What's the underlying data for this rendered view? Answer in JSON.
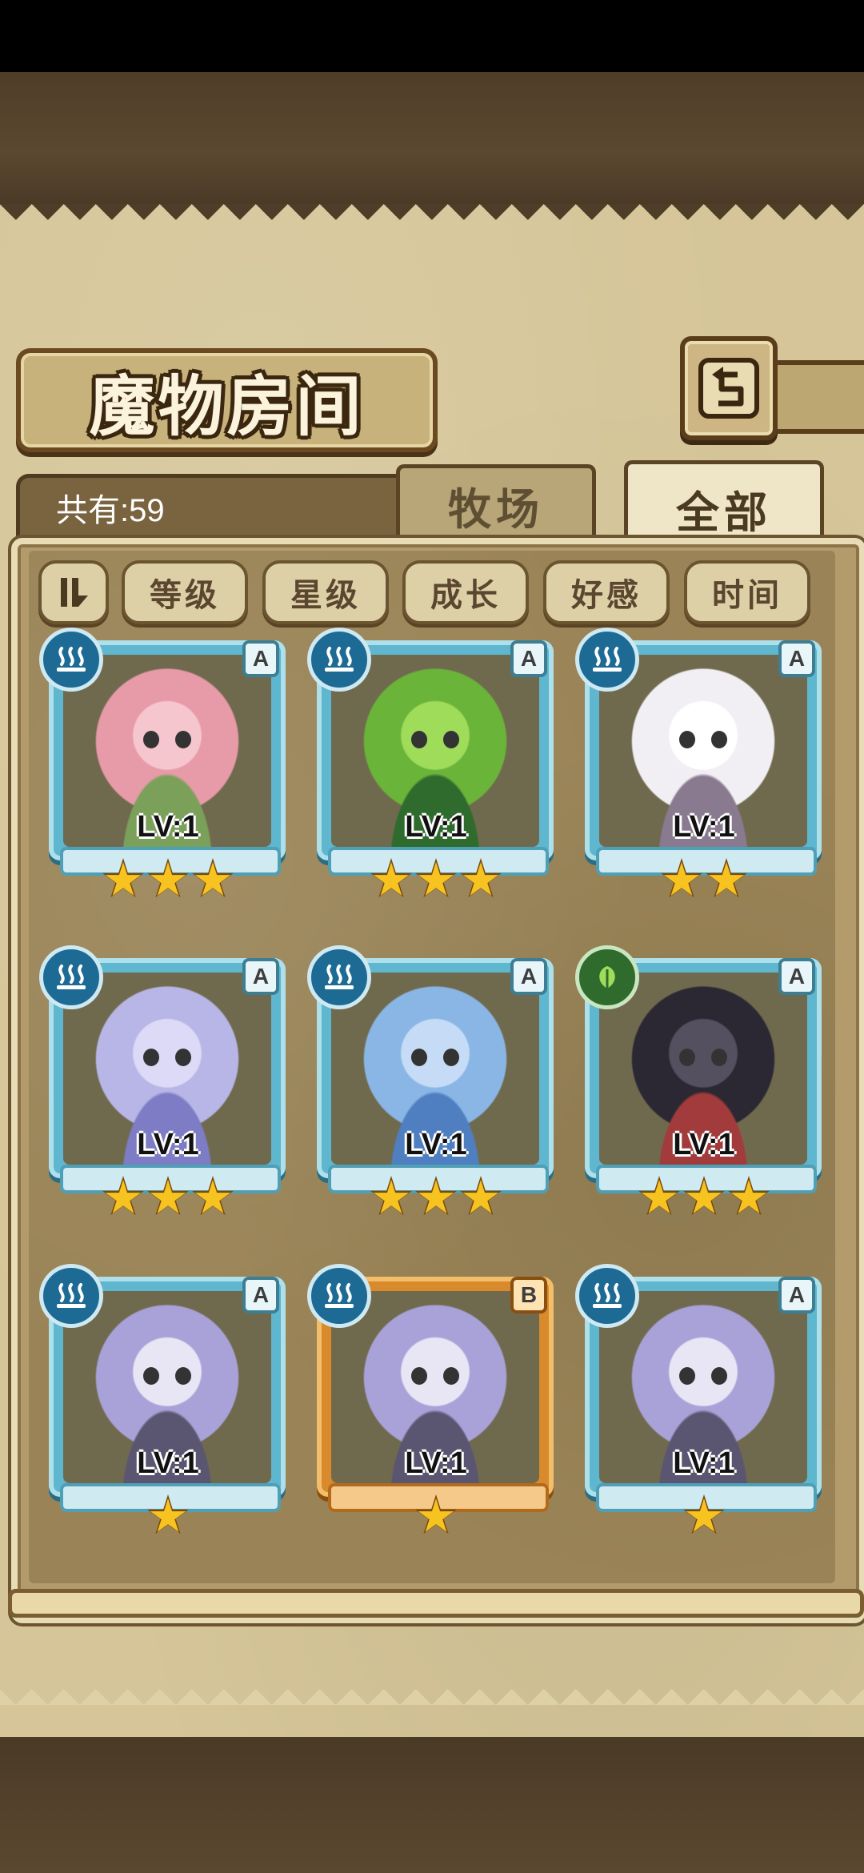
{
  "title": "魔物房间",
  "count_label": "共有:59",
  "tabs": [
    {
      "label": "牧场",
      "active": false
    },
    {
      "label": "全部",
      "active": true
    }
  ],
  "sort_buttons": [
    "等级",
    "星级",
    "成长",
    "好感",
    "时间"
  ],
  "accent_colors": {
    "frame_blue": "#5fb6cf",
    "frame_orange": "#d88a2c",
    "star": "#f7c320",
    "parchment": "#d5c598"
  },
  "monsters": [
    {
      "name": "pink-flower-girl",
      "element": "water",
      "rank": "A",
      "level": "LV:1",
      "stars": 3,
      "frame": "blue"
    },
    {
      "name": "green-frog-girl",
      "element": "water",
      "rank": "A",
      "level": "LV:1",
      "stars": 3,
      "frame": "blue"
    },
    {
      "name": "white-slime-girl",
      "element": "water",
      "rank": "A",
      "level": "LV:1",
      "stars": 2,
      "frame": "blue"
    },
    {
      "name": "ice-crystal-girl",
      "element": "water",
      "rank": "A",
      "level": "LV:1",
      "stars": 3,
      "frame": "blue"
    },
    {
      "name": "mermaid-harp-girl",
      "element": "water",
      "rank": "A",
      "level": "LV:1",
      "stars": 3,
      "frame": "blue"
    },
    {
      "name": "dark-hair-harpy-girl",
      "element": "leaf",
      "rank": "A",
      "level": "LV:1",
      "stars": 3,
      "frame": "blue"
    },
    {
      "name": "lavender-harpy-girl",
      "element": "water",
      "rank": "A",
      "level": "LV:1",
      "stars": 1,
      "frame": "blue"
    },
    {
      "name": "lavender-harpy-girl",
      "element": "water",
      "rank": "B",
      "level": "LV:1",
      "stars": 1,
      "frame": "orange"
    },
    {
      "name": "lavender-harpy-girl",
      "element": "water",
      "rank": "A",
      "level": "LV:1",
      "stars": 1,
      "frame": "blue"
    }
  ]
}
